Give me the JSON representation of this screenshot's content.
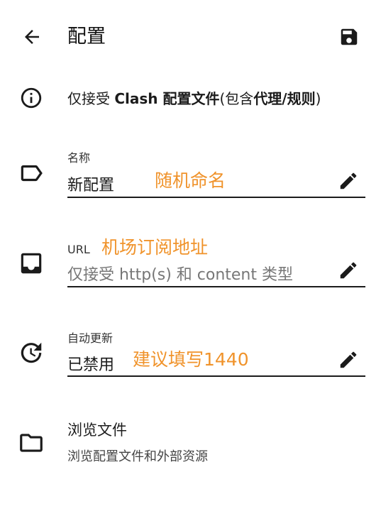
{
  "header": {
    "back_icon": "arrow-left-icon",
    "title": "配置",
    "save_icon": "save-icon"
  },
  "info": {
    "icon": "info-icon",
    "text_part1": "仅接受 ",
    "text_bold1": "Clash 配置文件",
    "text_part2": "(包含",
    "text_bold2": "代理/规则",
    "text_part3": ")"
  },
  "fields": {
    "name": {
      "icon": "label-icon",
      "label": "名称",
      "value": "新配置",
      "annotation": "随机命名",
      "edit_icon": "pencil-icon"
    },
    "url": {
      "icon": "inbox-icon",
      "label": "URL",
      "placeholder": "仅接受 http(s) 和 content 类型",
      "annotation": "机场订阅地址",
      "edit_icon": "pencil-icon"
    },
    "auto_update": {
      "icon": "update-icon",
      "label": "自动更新",
      "value": "已禁用",
      "annotation": "建议填写1440",
      "edit_icon": "pencil-icon"
    }
  },
  "browse": {
    "icon": "folder-icon",
    "title": "浏览文件",
    "subtitle": "浏览配置文件和外部资源"
  },
  "colors": {
    "annotation": "#f0932b",
    "text": "#1b1b1b"
  }
}
